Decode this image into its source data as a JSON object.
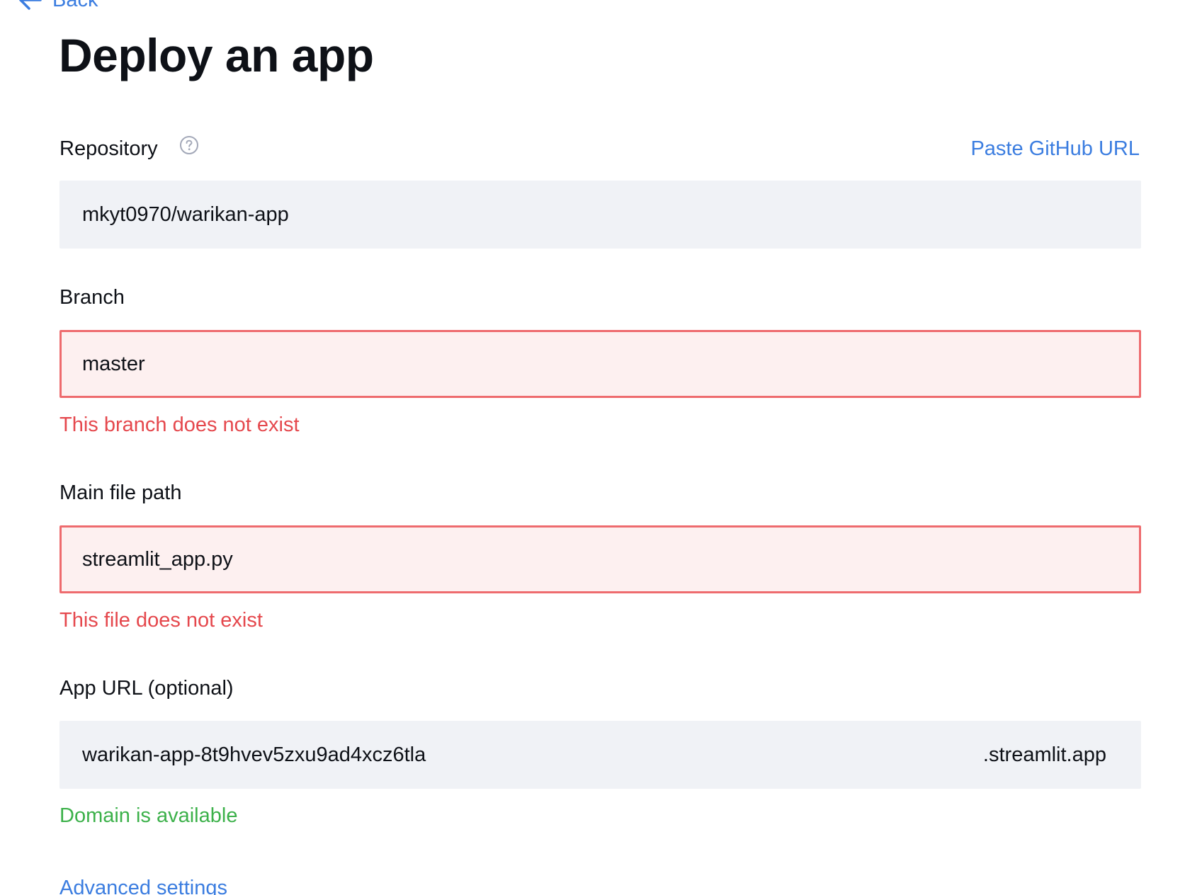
{
  "nav": {
    "back_label": "Back"
  },
  "page": {
    "title": "Deploy an app"
  },
  "repository": {
    "label": "Repository",
    "help_icon": "question-circle-icon",
    "paste_link": "Paste GitHub URL",
    "value": "mkyt0970/warikan-app"
  },
  "branch": {
    "label": "Branch",
    "value": "master",
    "error": "This branch does not exist"
  },
  "main_file": {
    "label": "Main file path",
    "value": "streamlit_app.py",
    "error": "This file does not exist"
  },
  "app_url": {
    "label": "App URL (optional)",
    "value": "warikan-app-8t9hvev5zxu9ad4xcz6tla",
    "suffix": ".streamlit.app",
    "status": "Domain is available"
  },
  "advanced": {
    "label": "Advanced settings"
  },
  "colors": {
    "link": "#3b7de0",
    "error": "#e5484d",
    "error_border": "#ee6b6e",
    "error_bg": "#fdf0f0",
    "success": "#3cb14a",
    "input_bg": "#f0f2f6"
  }
}
